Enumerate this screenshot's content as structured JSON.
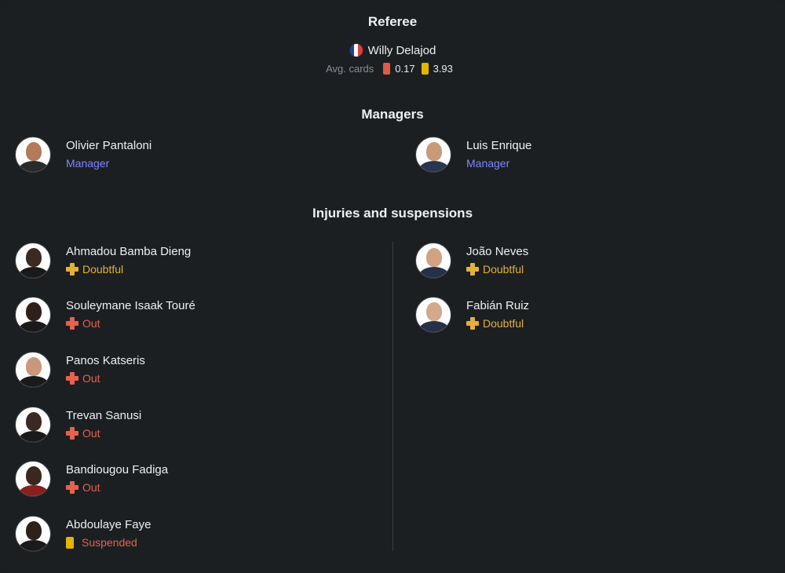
{
  "referee": {
    "title": "Referee",
    "name": "Willy Delajod",
    "flag_icon": "france-flag-icon",
    "avg_label": "Avg. cards",
    "red_avg": "0.17",
    "yellow_avg": "3.93",
    "red_color": "#e05a4a",
    "yellow_color": "#e3b400"
  },
  "managers": {
    "title": "Managers",
    "home": {
      "name": "Olivier Pantaloni",
      "role": "Manager"
    },
    "away": {
      "name": "Luis Enrique",
      "role": "Manager"
    }
  },
  "injuries": {
    "title": "Injuries and suspensions",
    "home": [
      {
        "name": "Ahmadou Bamba Dieng",
        "status": "Doubtful"
      },
      {
        "name": "Souleymane Isaak Touré",
        "status": "Out"
      },
      {
        "name": "Panos Katseris",
        "status": "Out"
      },
      {
        "name": "Trevan Sanusi",
        "status": "Out"
      },
      {
        "name": "Bandiougou Fadiga",
        "status": "Out"
      },
      {
        "name": "Abdoulaye Faye",
        "status": "Suspended"
      }
    ],
    "away": [
      {
        "name": "João Neves",
        "status": "Doubtful"
      },
      {
        "name": "Fabián Ruiz",
        "status": "Doubtful"
      }
    ]
  },
  "colors": {
    "doubtful": "#e3b13a",
    "out": "#e4624e",
    "role": "#7f85ff",
    "background": "#1c1f22"
  }
}
